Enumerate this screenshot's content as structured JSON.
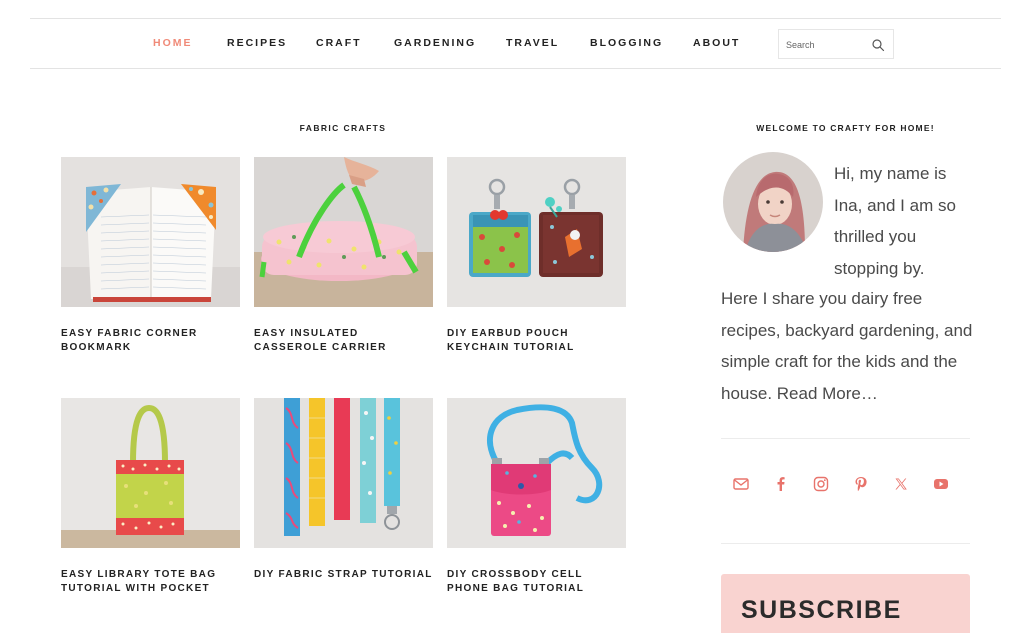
{
  "nav": {
    "items": [
      {
        "label": "HOME",
        "active": true
      },
      {
        "label": "RECIPES"
      },
      {
        "label": "CRAFT"
      },
      {
        "label": "GARDENING"
      },
      {
        "label": "TRAVEL"
      },
      {
        "label": "BLOGGING"
      },
      {
        "label": "ABOUT"
      }
    ],
    "search_placeholder": "Search",
    "search_icon": "magnifier-icon"
  },
  "main": {
    "section_title": "FABRIC CRAFTS",
    "posts": [
      {
        "title": "EASY FABRIC CORNER BOOKMARK"
      },
      {
        "title": "EASY INSULATED CASSEROLE CARRIER"
      },
      {
        "title": "DIY EARBUD POUCH KEYCHAIN TUTORIAL"
      },
      {
        "title": "EASY LIBRARY TOTE BAG TUTORIAL WITH POCKET"
      },
      {
        "title": "DIY FABRIC STRAP TUTORIAL"
      },
      {
        "title": "DIY CROSSBODY CELL PHONE BAG TUTORIAL"
      }
    ]
  },
  "sidebar": {
    "welcome_title": "WELCOME TO CRAFTY FOR HOME!",
    "intro_side": "Hi, my name is Ina, and I am so thrilled you stopping by.",
    "intro_full": "Here I share you dairy free recipes, backyard gardening, and simple craft for the kids and the house.",
    "read_more": "Read More…",
    "socials": [
      "email-icon",
      "facebook-icon",
      "instagram-icon",
      "pinterest-icon",
      "x-icon",
      "youtube-icon"
    ],
    "subscribe_title": "SUBSCRIBE"
  },
  "colors": {
    "accent": "#f08a78",
    "social": "#e8736b",
    "subscribe_bg": "#f9d3d0"
  }
}
